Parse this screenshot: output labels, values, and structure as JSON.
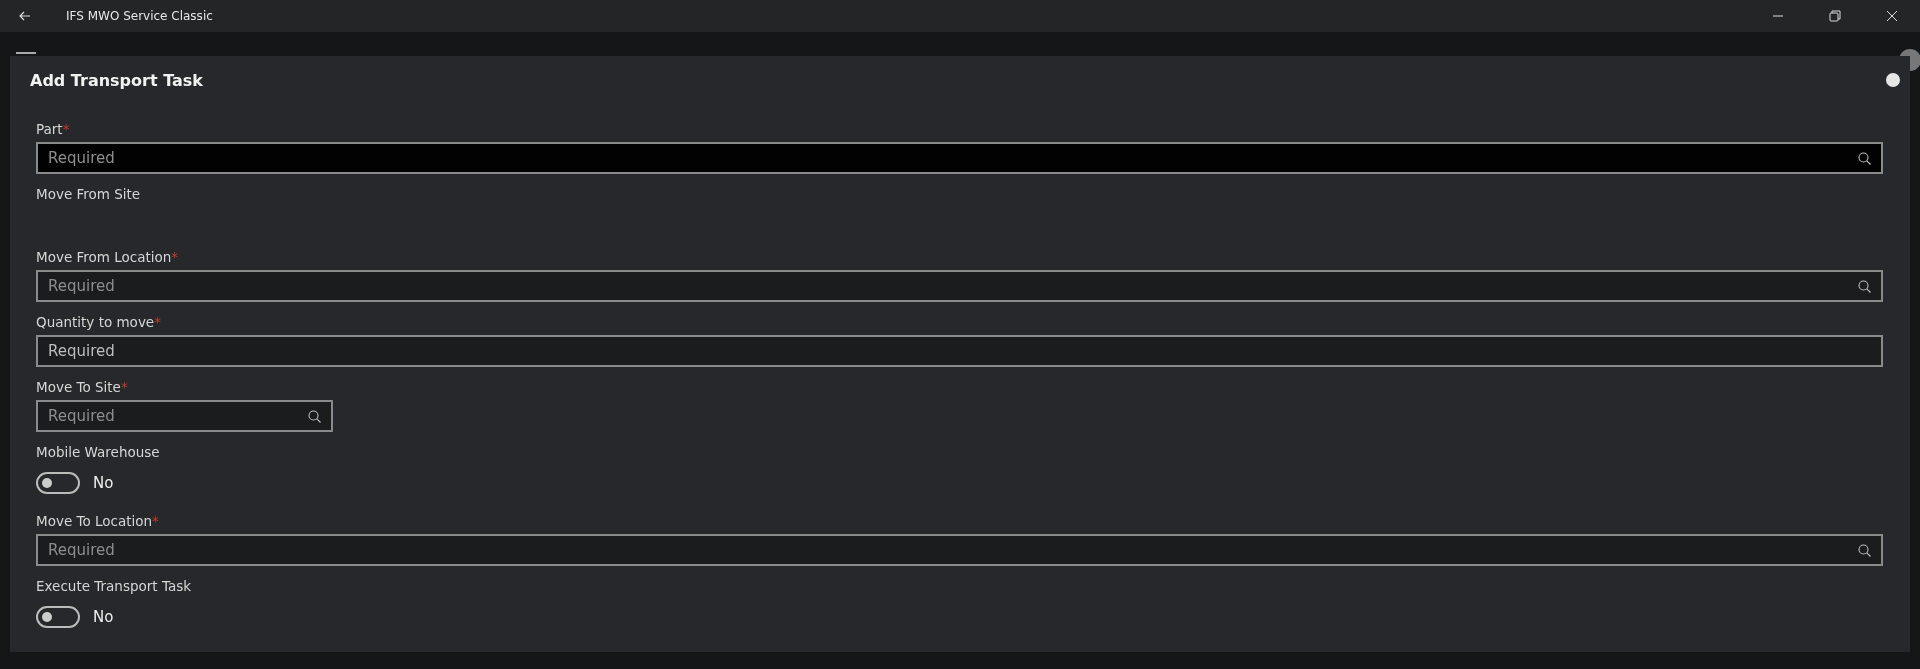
{
  "window": {
    "title": "IFS MWO Service Classic"
  },
  "dialog": {
    "title": "Add Transport Task",
    "fields": [
      {
        "kind": "lookup",
        "label": "Part",
        "required_mark": "*",
        "placeholder": "Required",
        "focused": true,
        "wide": true
      },
      {
        "kind": "readonly",
        "label": "Move From Site"
      },
      {
        "kind": "lookup",
        "label": "Move From Location",
        "required_mark": "*",
        "placeholder": "Required",
        "focused": false,
        "wide": true
      },
      {
        "kind": "text",
        "label": "Quantity to move",
        "required_mark": "*",
        "placeholder": "Required",
        "focused": false,
        "wide": true
      },
      {
        "kind": "lookup",
        "label": "Move To Site",
        "required_mark": "*",
        "placeholder": "Required",
        "focused": false,
        "wide": false
      },
      {
        "kind": "toggle",
        "label": "Mobile Warehouse",
        "on": false,
        "value": "No"
      },
      {
        "kind": "lookup",
        "label": "Move To Location",
        "required_mark": "*",
        "placeholder": "Required",
        "focused": false,
        "wide": true
      },
      {
        "kind": "toggle",
        "label": "Execute Transport Task",
        "on": false,
        "value": "No"
      }
    ]
  }
}
